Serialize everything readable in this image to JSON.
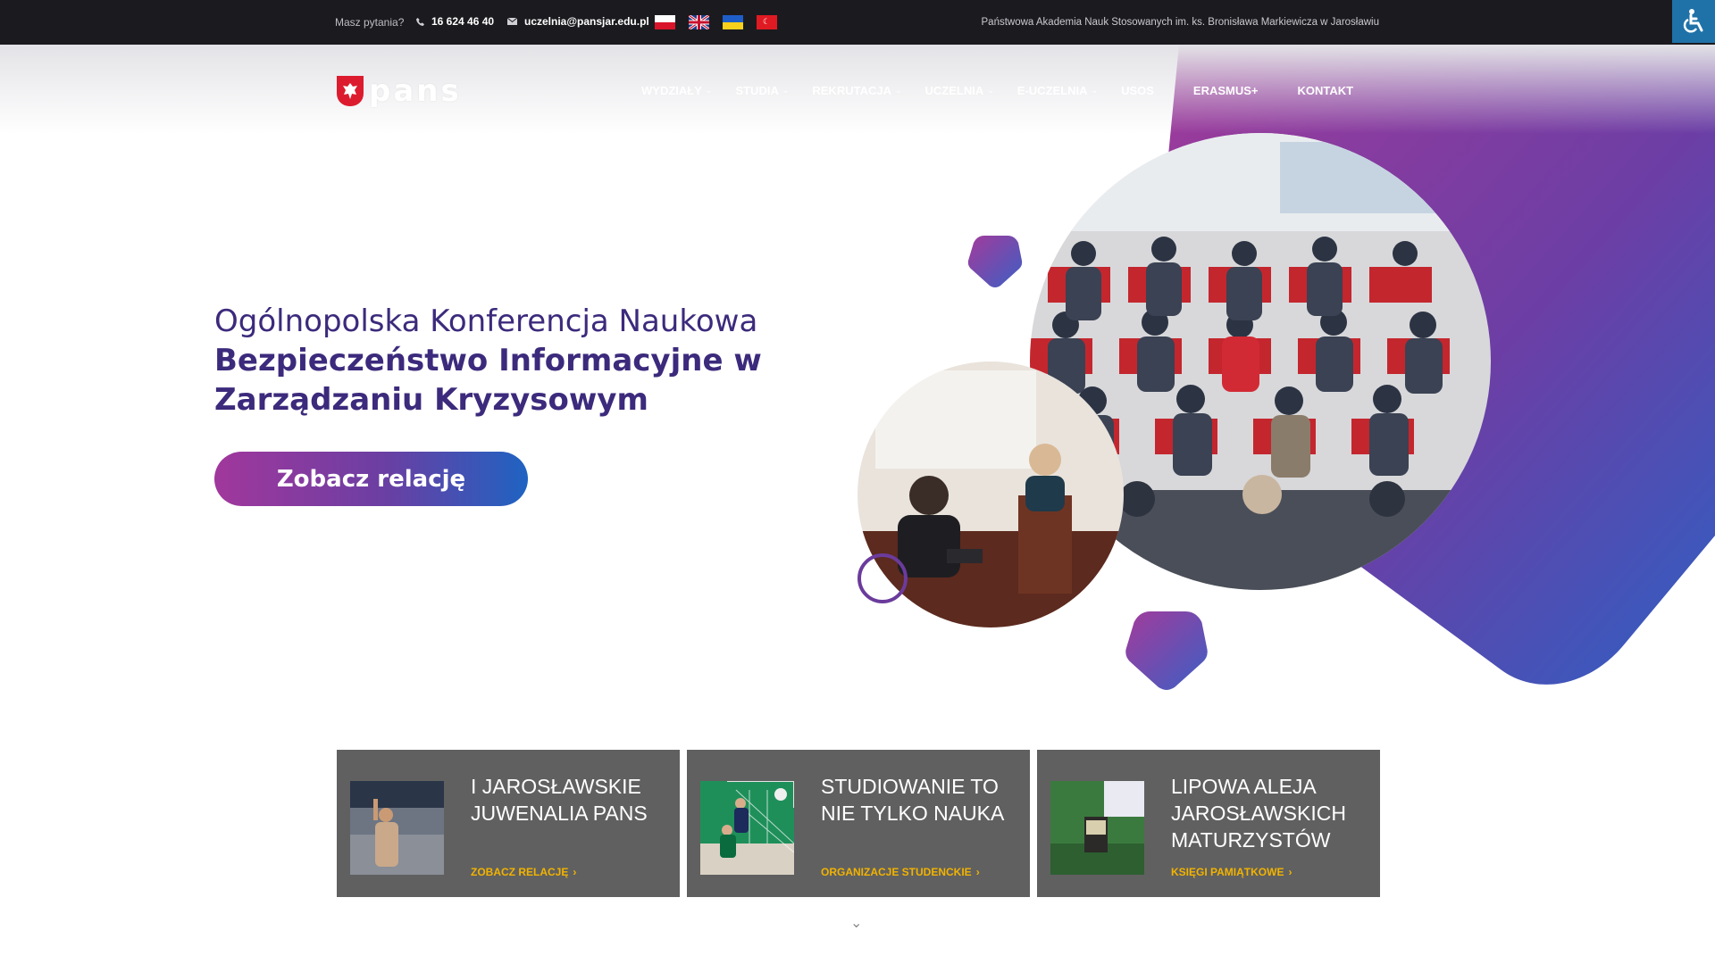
{
  "topbar": {
    "ask_label": "Masz pytania?",
    "phone": "16 624 46 40",
    "email": "uczelnia@pansjar.edu.pl",
    "institution": "Państwowa Akademia Nauk Stosowanych im. ks. Bronisława Markiewicza w Jarosławiu",
    "flags": [
      "pl",
      "en",
      "ua",
      "tr"
    ]
  },
  "logo": {
    "text": "pans"
  },
  "nav": {
    "items": [
      {
        "label": "WYDZIAŁY",
        "dropdown": true
      },
      {
        "label": "STUDIA",
        "dropdown": true
      },
      {
        "label": "REKRUTACJA",
        "dropdown": true
      },
      {
        "label": "UCZELNIA",
        "dropdown": true
      },
      {
        "label": "E-UCZELNIA",
        "dropdown": true
      },
      {
        "label": "USOS",
        "dropdown": false
      },
      {
        "label": "ERASMUS+",
        "dropdown": false
      },
      {
        "label": "KONTAKT",
        "dropdown": false
      }
    ]
  },
  "hero": {
    "line1": "Ogólnopolska Konferencja Naukowa",
    "line2": "Bezpieczeństwo Informacyjne w",
    "line3": "Zarządzaniu Kryzysowym",
    "cta": "Zobacz relację"
  },
  "cards": [
    {
      "title": "I JAROSŁAWSKIE JUWENALIA PANS",
      "link": "ZOBACZ RELACJĘ"
    },
    {
      "title": "STUDIOWANIE TO NIE TYLKO NAUKA",
      "link": "ORGANIZACJE STUDENCKIE"
    },
    {
      "title": "LIPOWA ALEJA JAROSŁAWSKICH MATURZYSTÓW",
      "link": "KSIĘGI PAMIĄTKOWE"
    }
  ],
  "colors": {
    "accent_purple": "#3c2a7c",
    "gradient_start": "#a1379c",
    "gradient_end": "#1f63c2",
    "card_bg": "#606060",
    "card_link": "#f2b300"
  }
}
